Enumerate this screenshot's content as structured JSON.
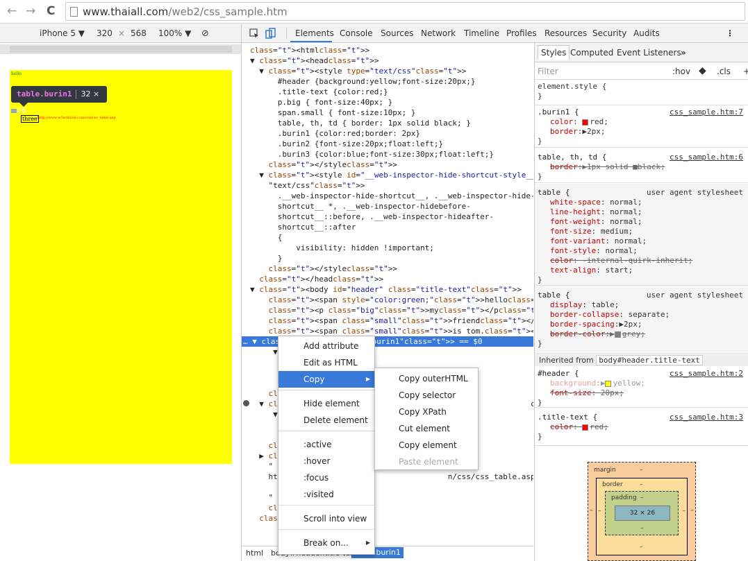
{
  "browser": {
    "url_host": "www.thaiall.com",
    "url_path": "/web2/css_sample.htm",
    "back": "←",
    "forward": "→",
    "reload": "C"
  },
  "device": {
    "name": "iPhone 5 ▼",
    "width": "320",
    "times": "×",
    "height": "568",
    "zoom": "100% ▼"
  },
  "page": {
    "hello": "hello",
    "three": "three",
    "link": "http://www.w3schools.com/css/css_table.asp"
  },
  "tooltip": {
    "selector": "table.burin1",
    "size": "32 × 26"
  },
  "devtools": {
    "tabs": [
      "Elements",
      "Console",
      "Sources",
      "Network",
      "Timeline",
      "Profiles",
      "Resources",
      "Security",
      "Audits"
    ],
    "more": "⋮"
  },
  "dom_lines": [
    "<html>",
    "▼ <head>",
    "  ▼ <style type=\"text/css\">",
    "      #header {background:yellow;font-size:20px;}",
    "      .title-text {color:red;}",
    "      p.big { font-size:40px; }",
    "      span.small { font-size:10px; }",
    "      table, th, td { border: 1px solid black; }",
    "      .burin1 {color:red;border: 2px}",
    "      .burin2 {font-size:20px;float:left;}",
    "      .burin3 {color:blue;font-size:30px;float:left;}",
    "    </style>",
    "  ▼ <style id=\"__web-inspector-hide-shortcut-style__\" type=",
    "    \"text/css\">",
    "      .__web-inspector-hide-shortcut__, .__web-inspector-hide-",
    "      shortcut__ *, .__web-inspector-hidebefore-",
    "      shortcut__::before, .__web-inspector-hideafter-",
    "      shortcut__::after",
    "      {",
    "          visibility: hidden !important;",
    "      }",
    "    </style>",
    "  </head>",
    "▼ <body id=\"header\" class=\"title-text\">",
    "    <span style=\"color:green;\">hello</span>",
    "    <p class=\"big\">my</p>",
    "    <span class=\"small\">friend</span>",
    "    <span class=\"small\">is tom.</span>",
    "… ▼ <table class=\"burin1\"> == $0",
    "     ▼",
    "      ",
    "      ",
    "      ",
    "    </",
    "  ▼ <t                                             ctut__\">",
    "     ▼",
    "      ",
    "      ",
    "    </",
    "  ▶ <t",
    "    \"",
    "    ht                                     n/css/css_table.asp",
    "      ",
    "    \"",
    "    </bo",
    "  </html"
  ],
  "breadcrumbs": [
    "html",
    "body#header.title-text",
    "table.burin1"
  ],
  "styles": {
    "tabs": [
      "Styles",
      "Computed",
      "Event Listeners",
      "»"
    ],
    "filter": "Filter",
    "hov": ":hov",
    "cls": ".cls",
    "plus": "+",
    "element_style": "element.style {",
    "close": "}",
    "burin1": {
      "sel": ".burin1 {",
      "src": "css_sample.htm:7",
      "p1n": "color",
      "p1v": "red;",
      "p2n": "border",
      "p2v": "2px;"
    },
    "table_rule": {
      "sel": "table, th, td {",
      "src": "css_sample.htm:6",
      "pn": "border",
      "pv": "1px solid ■black;"
    },
    "ua1": {
      "sel": "table {",
      "src": "user agent stylesheet",
      "props": [
        [
          "white-space",
          "normal;"
        ],
        [
          "line-height",
          "normal;"
        ],
        [
          "font-weight",
          "normal;"
        ],
        [
          "font-size",
          "medium;"
        ],
        [
          "font-variant",
          "normal;"
        ],
        [
          "font-style",
          "normal;"
        ],
        [
          "color",
          "-internal-quirk-inherit;"
        ],
        [
          "text-align",
          "start;"
        ]
      ]
    },
    "ua2": {
      "sel": "table {",
      "src": "user agent stylesheet",
      "props": [
        [
          "display",
          "table;"
        ],
        [
          "border-collapse",
          "separate;"
        ],
        [
          "border-spacing",
          "2px;"
        ],
        [
          "border-color",
          "grey;"
        ]
      ]
    },
    "inherited": "Inherited from",
    "inherited_pill": "body#header.title-text",
    "header": {
      "sel": "#header {",
      "src": "css_sample.htm:2",
      "p1n": "background",
      "p1v": "yellow;",
      "p2n": "font-size",
      "p2v": "20px;"
    },
    "title": {
      "sel": ".title-text {",
      "src": "css_sample.htm:3",
      "pn": "color",
      "pv": "red;"
    }
  },
  "boxmodel": {
    "margin": "margin",
    "border": "border",
    "padding": "padding",
    "content": "32 × 26",
    "dash": "–"
  },
  "context_menu": [
    "Add attribute",
    "Edit as HTML",
    "Copy",
    "Hide element",
    "Delete element",
    ":active",
    ":hover",
    ":focus",
    ":visited",
    "Scroll into view",
    "Break on..."
  ],
  "copy_menu": [
    "Copy outerHTML",
    "Copy selector",
    "Copy XPath",
    "Cut element",
    "Copy element",
    "Paste element"
  ],
  "colors": {
    "selection": "#3879d9",
    "page_bg": "#ffff00",
    "tag": "#881280",
    "attr": "#994500",
    "value": "#1a1aa6"
  }
}
